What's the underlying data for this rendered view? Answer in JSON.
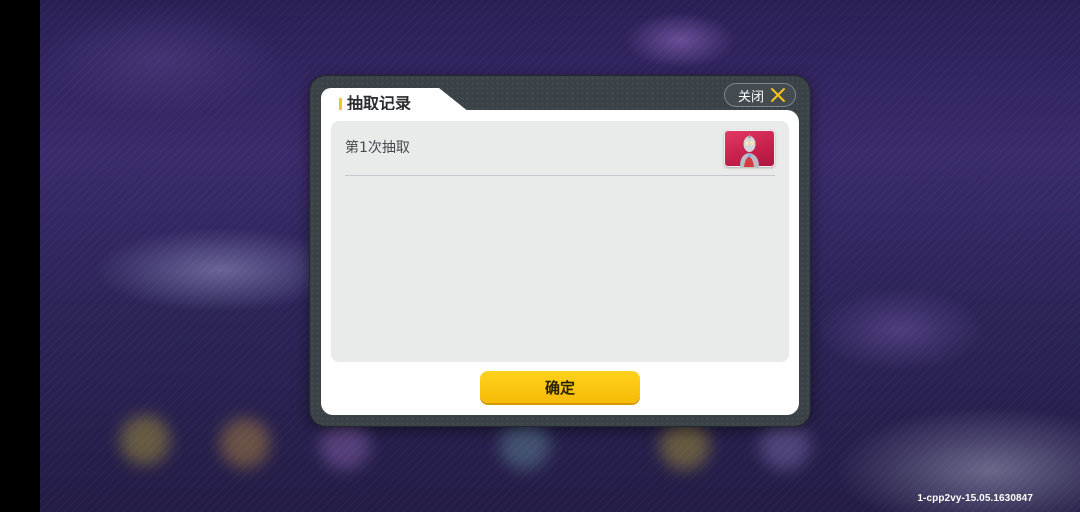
{
  "dialog": {
    "title": "抽取记录",
    "close_label": "关闭",
    "close_icon": "close-x-icon",
    "confirm_label": "确定",
    "records": [
      {
        "label": "第1次抽取",
        "reward_icon": "ultraman-figure-icon"
      }
    ]
  },
  "footer": {
    "version": "1-cpp2vy-15.05.1630847"
  },
  "colors": {
    "accent": "#f7c31c",
    "confirm_button": "#fcc70e",
    "dialog_frame": "#3b4247",
    "reward_card": "#d62a55"
  }
}
